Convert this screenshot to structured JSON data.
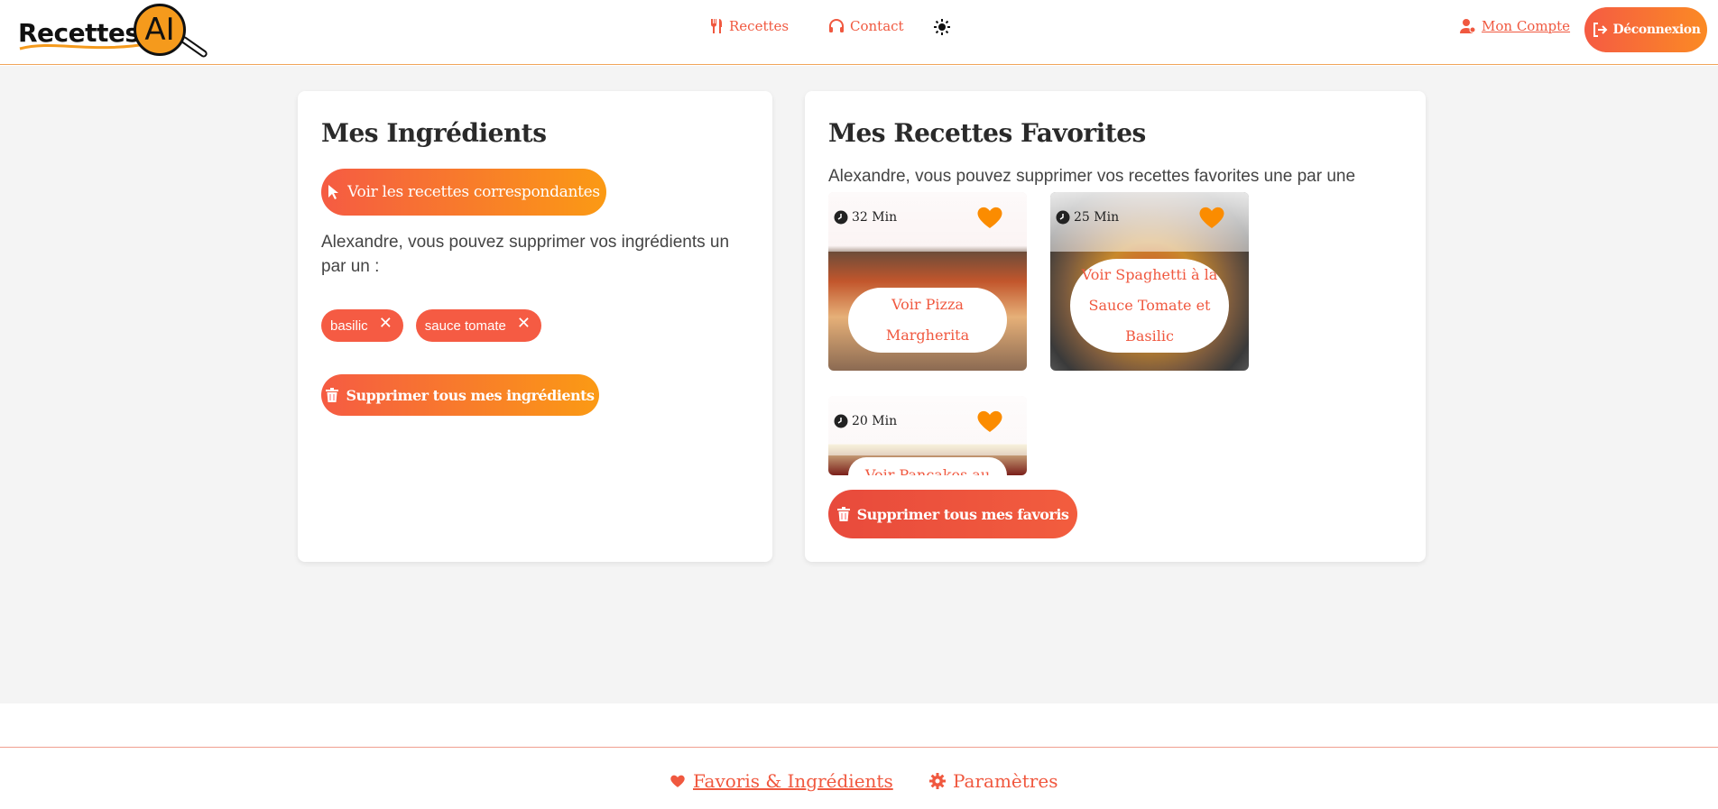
{
  "header": {
    "logo_text": "Recettes",
    "logo_ai": "AI",
    "nav": {
      "recettes_label": "Recettes",
      "recettes_icon": "utensils-icon",
      "contact_label": "Contact",
      "contact_icon": "headset-icon",
      "theme_icon": "sun-icon",
      "account_label": "Mon Compte",
      "account_icon": "user-icon",
      "logout_label": "Déconnexion",
      "logout_icon": "logout-icon"
    }
  },
  "ingredients_card": {
    "title": "Mes Ingrédients",
    "view_button_label": "Voir les recettes correspondantes",
    "message": "Alexandre, vous pouvez supprimer vos ingrédients un par un :",
    "chips": [
      "basilic",
      "sauce tomate"
    ],
    "chip_remove_glyph": "✕",
    "delete_all_label": "Supprimer tous mes ingrédients"
  },
  "favorites_card": {
    "title": "Mes Recettes Favorites",
    "message": "Alexandre, vous pouvez supprimer vos recettes favorites une par une",
    "recipes": [
      {
        "time": "32 Min",
        "label": "Voir Pizza Margherita"
      },
      {
        "time": "25 Min",
        "label": "Voir Spaghetti à la Sauce Tomate et Basilic"
      },
      {
        "time": "20 Min",
        "label": "Voir Pancakes au"
      }
    ],
    "delete_all_label": "Supprimer tous mes favoris"
  },
  "footer": {
    "favorites_label": "Favoris & Ingrédients",
    "settings_label": "Paramètres"
  },
  "colors": {
    "accent": "#f0583f",
    "accent_gradient_end": "#fb9a14",
    "heart": "#fb8c00",
    "background": "#f4f4f4"
  }
}
